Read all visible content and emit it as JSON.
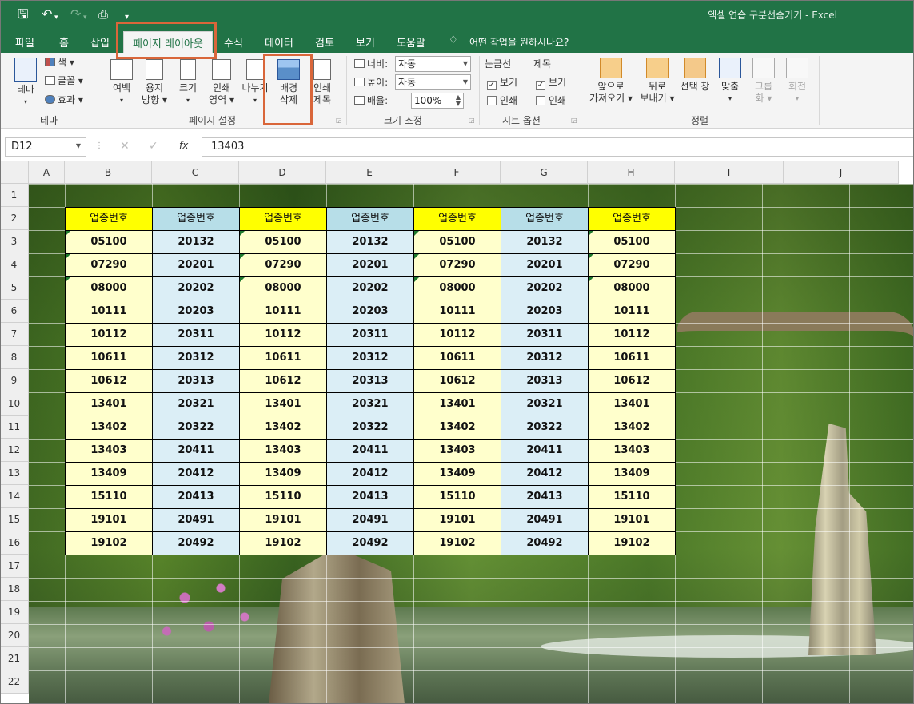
{
  "window": {
    "title": "엑셀 연습 구분선숨기기  -  Excel"
  },
  "quick_access": {
    "save_icon": "save-icon",
    "undo_icon": "undo-icon",
    "redo_icon": "redo-icon",
    "preview_icon": "print-preview-icon",
    "customize_icon": "customize-icon"
  },
  "tabs": [
    "파일",
    "홈",
    "삽입",
    "페이지 레이아웃",
    "수식",
    "데이터",
    "검토",
    "보기",
    "도움말"
  ],
  "active_tab": "페이지 레이아웃",
  "tell_me": "어떤 작업을 원하시나요?",
  "ribbon": {
    "theme_group": {
      "label": "테마",
      "theme_button": "테마",
      "colors": "색",
      "fonts": "글꼴",
      "effects": "효과"
    },
    "page_setup": {
      "label": "페이지 설정",
      "margins": "여백",
      "orientation": [
        "용지",
        "방향"
      ],
      "size": "크기",
      "print_area": [
        "인쇄",
        "영역"
      ],
      "breaks": "나누기",
      "background_delete": [
        "배경",
        "삭제"
      ],
      "print_titles": [
        "인쇄",
        "제목"
      ]
    },
    "scale": {
      "label": "크기 조정",
      "width_label": "너비:",
      "width_value": "자동",
      "height_label": "높이:",
      "height_value": "자동",
      "scale_label": "배율:",
      "scale_value": "100%"
    },
    "sheet_options": {
      "label": "시트 옵션",
      "gridlines": "눈금선",
      "headings": "제목",
      "view": "보기",
      "print": "인쇄",
      "gridlines_view": true,
      "gridlines_print": false,
      "headings_view": true,
      "headings_print": false
    },
    "arrange": {
      "label": "정렬",
      "bring_forward": [
        "앞으로",
        "가져오기"
      ],
      "send_backward": [
        "뒤로",
        "보내기"
      ],
      "selection_pane": "선택 창",
      "align": "맞춤",
      "group": [
        "그룹",
        "화"
      ],
      "rotate": "회전"
    }
  },
  "formula_bar": {
    "name_box": "D12",
    "cancel": "✕",
    "enter": "✓",
    "fx": "fx",
    "formula": "13403"
  },
  "grid": {
    "columns": [
      "A",
      "B",
      "C",
      "D",
      "E",
      "F",
      "G",
      "H",
      "I",
      "J"
    ],
    "rows": [
      "1",
      "2",
      "3",
      "4",
      "5",
      "6",
      "7",
      "8",
      "9",
      "10",
      "11",
      "12",
      "13",
      "14",
      "15",
      "16",
      "17",
      "18",
      "19",
      "20",
      "21",
      "22"
    ],
    "table_header": [
      "업종번호",
      "업종번호",
      "업종번호",
      "업종번호",
      "업종번호",
      "업종번호",
      "업종번호"
    ],
    "table_rows": [
      [
        "05100",
        "20132",
        "05100",
        "20132",
        "05100",
        "20132",
        "05100"
      ],
      [
        "07290",
        "20201",
        "07290",
        "20201",
        "07290",
        "20201",
        "07290"
      ],
      [
        "08000",
        "20202",
        "08000",
        "20202",
        "08000",
        "20202",
        "08000"
      ],
      [
        "10111",
        "20203",
        "10111",
        "20203",
        "10111",
        "20203",
        "10111"
      ],
      [
        "10112",
        "20311",
        "10112",
        "20311",
        "10112",
        "20311",
        "10112"
      ],
      [
        "10611",
        "20312",
        "10611",
        "20312",
        "10611",
        "20312",
        "10611"
      ],
      [
        "10612",
        "20313",
        "10612",
        "20313",
        "10612",
        "20313",
        "10612"
      ],
      [
        "13401",
        "20321",
        "13401",
        "20321",
        "13401",
        "20321",
        "13401"
      ],
      [
        "13402",
        "20322",
        "13402",
        "20322",
        "13402",
        "20322",
        "13402"
      ],
      [
        "13403",
        "20411",
        "13403",
        "20411",
        "13403",
        "20411",
        "13403"
      ],
      [
        "13409",
        "20412",
        "13409",
        "20412",
        "13409",
        "20412",
        "13409"
      ],
      [
        "15110",
        "20413",
        "15110",
        "20413",
        "15110",
        "20413",
        "15110"
      ],
      [
        "19101",
        "20491",
        "19101",
        "20491",
        "19101",
        "20491",
        "19101"
      ],
      [
        "19102",
        "20492",
        "19102",
        "20492",
        "19102",
        "20492",
        "19102"
      ]
    ]
  },
  "colors": {
    "excel_green": "#217346",
    "highlight": "#d9663a",
    "header_yellow": "#ffff00",
    "header_blue": "#b7dee8",
    "cell_yellow": "#ffffcc",
    "cell_blue": "#dbeef6"
  }
}
